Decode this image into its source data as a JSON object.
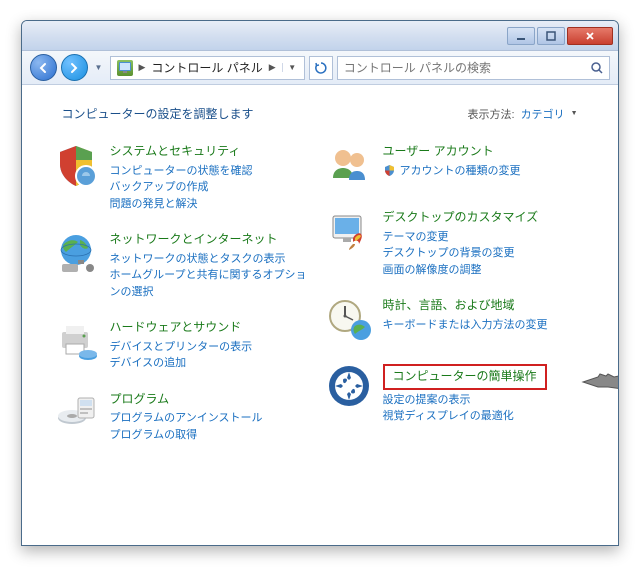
{
  "titlebar": {
    "min": "_",
    "max": "☐",
    "close": "✕"
  },
  "addressbar": {
    "back_arrow": "←",
    "fwd_arrow": "→",
    "drop": "▼",
    "crumb_icon_label": "⚙",
    "crumb_sep": "▶",
    "crumb_text": "コントロール パネル",
    "crumb_arrow2": "▶",
    "crumb_drop": "▼",
    "refresh": "↻",
    "search_placeholder": "コントロール パネルの検索",
    "search_icon": "🔍"
  },
  "header": {
    "title": "コンピューターの設定を調整します",
    "view_label": "表示方法:",
    "view_value": "カテゴリ",
    "view_drop": "▼"
  },
  "cats": {
    "system": {
      "title": "システムとセキュリティ",
      "links": [
        "コンピューターの状態を確認",
        "バックアップの作成",
        "問題の発見と解決"
      ]
    },
    "network": {
      "title": "ネットワークとインターネット",
      "links": [
        "ネットワークの状態とタスクの表示",
        "ホームグループと共有に関するオプションの選択"
      ]
    },
    "hardware": {
      "title": "ハードウェアとサウンド",
      "links": [
        "デバイスとプリンターの表示",
        "デバイスの追加"
      ]
    },
    "programs": {
      "title": "プログラム",
      "links": [
        "プログラムのアンインストール",
        "プログラムの取得"
      ]
    },
    "user": {
      "title": "ユーザー アカウント",
      "links": [
        "アカウントの種類の変更"
      ]
    },
    "appearance": {
      "title": "デスクトップのカスタマイズ",
      "links": [
        "テーマの変更",
        "デスクトップの背景の変更",
        "画面の解像度の調整"
      ]
    },
    "clock": {
      "title": "時計、言語、および地域",
      "links": [
        "キーボードまたは入力方法の変更"
      ]
    },
    "ease": {
      "title": "コンピューターの簡単操作",
      "links": [
        "設定の提案の表示",
        "視覚ディスプレイの最適化"
      ]
    }
  }
}
